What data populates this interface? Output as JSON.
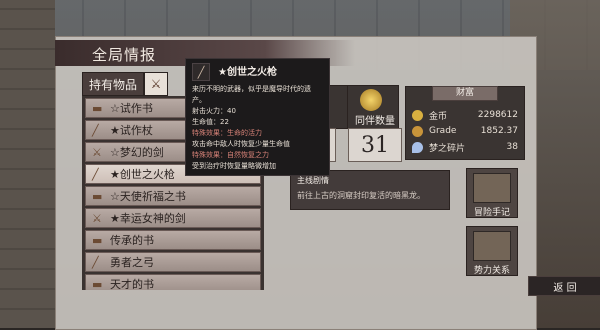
{
  "window": {
    "title": "全局情报"
  },
  "tabs": {
    "items_label": "持有物品"
  },
  "list": {
    "items": [
      {
        "icon": "book-icon",
        "label": "☆试作书"
      },
      {
        "icon": "staff-icon",
        "label": "★试作杖"
      },
      {
        "icon": "sword-icon",
        "label": "☆梦幻的剑"
      },
      {
        "icon": "gun-icon",
        "label": "★创世之火枪",
        "selected": true
      },
      {
        "icon": "book-icon",
        "label": "☆天使祈福之书"
      },
      {
        "icon": "sword-icon",
        "label": "★幸运女神的剑"
      },
      {
        "icon": "book-icon",
        "label": "传承的书"
      },
      {
        "icon": "bow-icon",
        "label": "勇者之弓"
      },
      {
        "icon": "book-icon",
        "label": "天才的书"
      }
    ]
  },
  "tooltip": {
    "title": "★创世之火枪",
    "lines": [
      {
        "text": "来历不明的武器，似乎是魔导时代的遗",
        "tone": "normal"
      },
      {
        "text": "产。",
        "tone": "normal"
      },
      {
        "text": "射击火力：40",
        "tone": "normal"
      },
      {
        "text": "生命值：22",
        "tone": "normal"
      },
      {
        "text": "特殊效果：生命的活力",
        "tone": "red"
      },
      {
        "text": "攻击命中敌人时恢复少量生命值",
        "tone": "normal"
      },
      {
        "text": "特殊效果：自然恢复之力",
        "tone": "red"
      },
      {
        "text": "受到治疗时恢复量略微增加",
        "tone": "normal"
      }
    ]
  },
  "stats": {
    "left_number": "1",
    "companions_label": "同伴数量",
    "companions_value": "31"
  },
  "wealth": {
    "heading": "财富",
    "rows": [
      {
        "label": "金币",
        "value": "2298612",
        "color": "#d9b040"
      },
      {
        "label": "Grade",
        "value": "1852.37",
        "color": "#c8943a"
      },
      {
        "label": "梦之碎片",
        "value": "38",
        "color": "#a8c0e8"
      }
    ]
  },
  "main_quest": {
    "title": "主线剧情",
    "desc": "前往上古的洞窟封印复活的暗黑龙。"
  },
  "buttons": {
    "journal": "冒险手记",
    "faction": "势力关系",
    "back": "返 回"
  }
}
